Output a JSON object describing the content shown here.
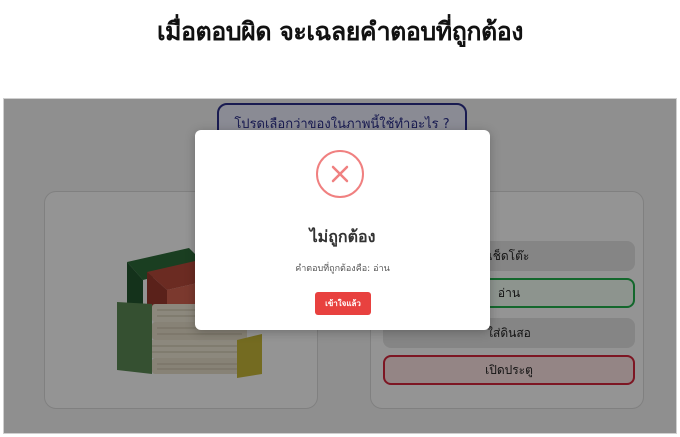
{
  "page": {
    "title": "เมื่อตอบผิด จะเฉลยคำตอบที่ถูกต้อง"
  },
  "quiz": {
    "question": "โปรดเลือกว่าของในภาพนี้ใช้ทำอะไร ?",
    "image_icon": "stack-of-books",
    "options": [
      {
        "label": "เช็ดโต๊ะ",
        "state": "dimmed"
      },
      {
        "label": "อ่าน",
        "state": "correct"
      },
      {
        "label": "ใส่ดินสอ",
        "state": "dimmed"
      },
      {
        "label": "เปิดประตู",
        "state": "wrong"
      }
    ]
  },
  "modal": {
    "icon": "error-x-circle-icon",
    "title": "ไม่ถูกต้อง",
    "message_prefix": "คำตอบที่ถูกต้องคือ:",
    "correct_answer": "อ่าน",
    "button_label": "เข้าใจแล้ว"
  },
  "colors": {
    "correct": "#22b14c",
    "wrong": "#d7263d",
    "error_icon": "#f08080",
    "button": "#e8413f",
    "question_border": "#2b2f8c"
  }
}
